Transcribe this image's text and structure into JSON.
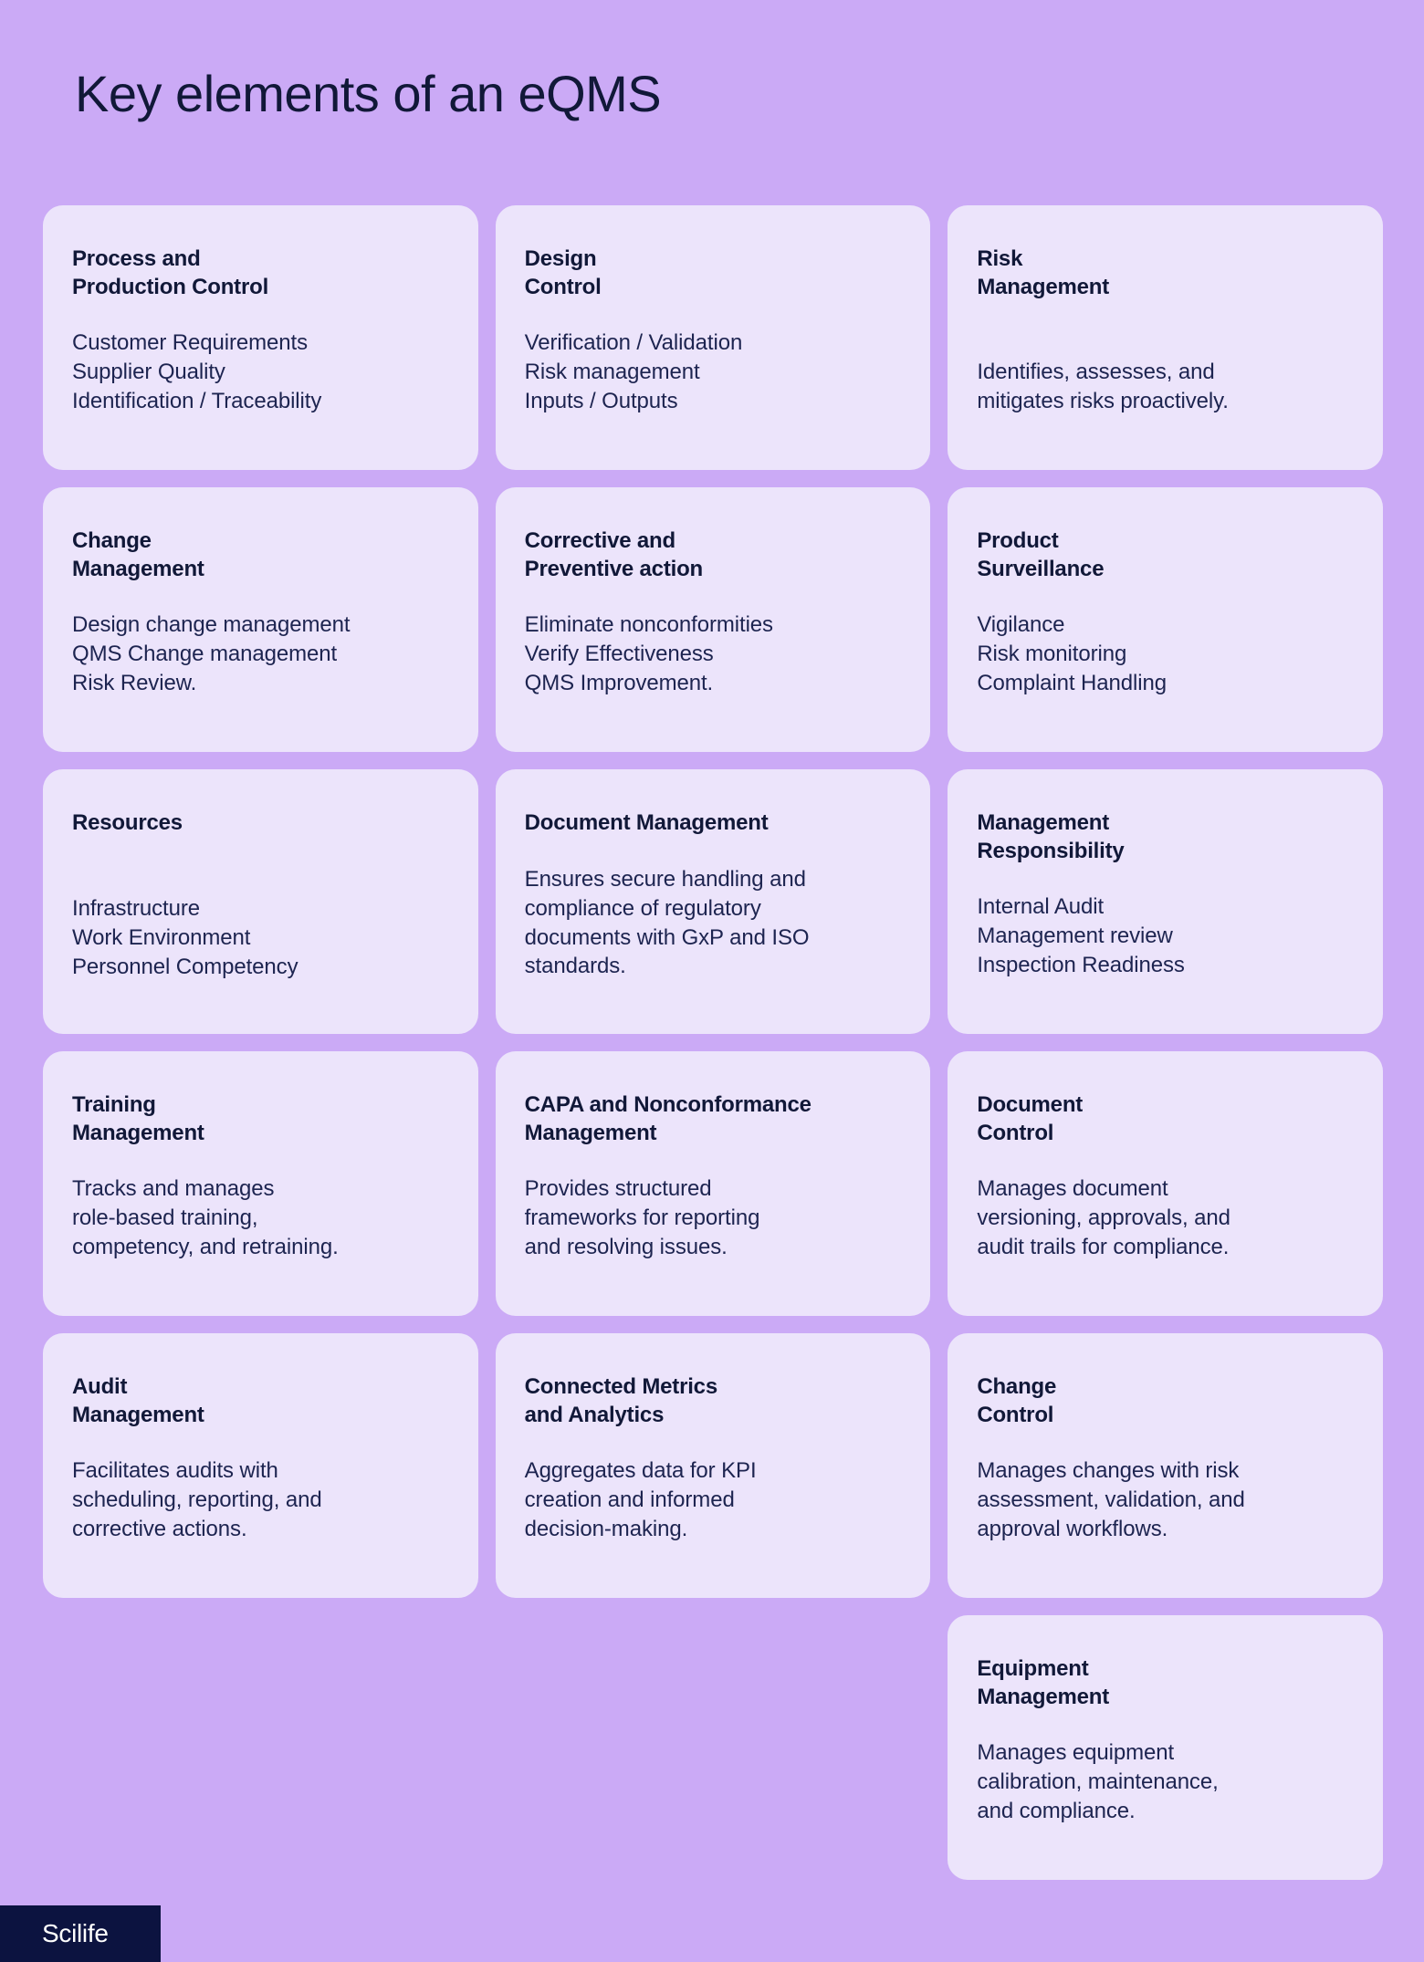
{
  "page": {
    "title": "Key elements of an eQMS",
    "background_color": "#cbaaf6",
    "card_color": "#ece4fb",
    "text_color": "#111838",
    "logo_background_color": "#0c1340"
  },
  "logo": {
    "text": "Scilife"
  },
  "cards": [
    {
      "title": "Process and\nProduction Control",
      "body": "Customer Requirements\nSupplier Quality\nIdentification / Traceability",
      "extra_gap": false
    },
    {
      "title": "Design\nControl",
      "body": "Verification / Validation\nRisk management\nInputs / Outputs",
      "extra_gap": false
    },
    {
      "title": "Risk\nManagement",
      "body": "Identifies, assesses, and\nmitigates risks proactively.",
      "extra_gap": true
    },
    {
      "title": "Change\nManagement",
      "body": "Design change management\nQMS Change management\nRisk Review.",
      "extra_gap": false
    },
    {
      "title": "Corrective and\nPreventive action",
      "body": "Eliminate nonconformities\nVerify Effectiveness\nQMS Improvement.",
      "extra_gap": false
    },
    {
      "title": "Product\nSurveillance",
      "body": "Vigilance\nRisk monitoring\nComplaint Handling",
      "extra_gap": false
    },
    {
      "title": "Resources",
      "body": "Infrastructure\nWork Environment\nPersonnel Competency",
      "extra_gap": true
    },
    {
      "title": "Document Management",
      "body": "Ensures secure handling and\ncompliance of regulatory\ndocuments with GxP and ISO\nstandards.",
      "extra_gap": false
    },
    {
      "title": "Management\nResponsibility",
      "body": "Internal Audit\nManagement review\nInspection Readiness",
      "extra_gap": false
    },
    {
      "title": "Training\nManagement",
      "body": "Tracks and manages\nrole-based training,\ncompetency, and retraining.",
      "extra_gap": false
    },
    {
      "title": "CAPA and Nonconformance\nManagement",
      "body": "Provides structured\nframeworks for reporting\nand resolving issues.",
      "extra_gap": false
    },
    {
      "title": "Document\nControl",
      "body": "Manages document\nversioning, approvals, and\naudit trails for compliance.",
      "extra_gap": false
    },
    {
      "title": "Audit\nManagement",
      "body": "Facilitates audits with\nscheduling, reporting, and\ncorrective actions.",
      "extra_gap": false
    },
    {
      "title": "Connected Metrics\nand Analytics",
      "body": "Aggregates data for KPI\ncreation and informed\ndecision-making.",
      "extra_gap": false
    },
    {
      "title": "Change\nControl",
      "body": "Manages changes with risk\nassessment, validation, and\napproval workflows.",
      "extra_gap": false
    },
    {
      "title": "Equipment\nManagement",
      "body": "Manages equipment\ncalibration, maintenance,\nand compliance.",
      "extra_gap": false
    }
  ]
}
